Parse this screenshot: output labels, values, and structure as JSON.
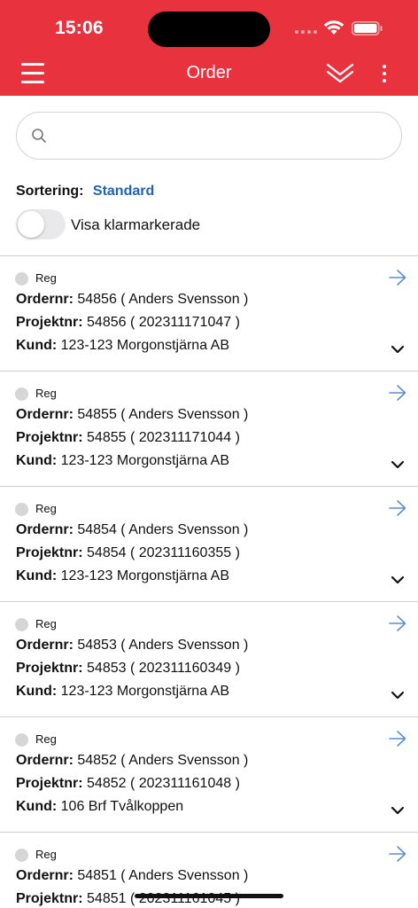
{
  "status_bar": {
    "time": "15:06"
  },
  "appbar": {
    "title": "Order",
    "bg_color": "#e8323e"
  },
  "search": {
    "placeholder": "",
    "value": ""
  },
  "sort": {
    "label": "Sortering:",
    "value": "Standard"
  },
  "toggle": {
    "label": "Visa klarmarkerade",
    "on": false
  },
  "labels": {
    "order": "Ordernr:",
    "project": "Projektnr:",
    "customer": "Kund:"
  },
  "orders": [
    {
      "status": "Reg",
      "order": "54856 ( Anders Svensson )",
      "project": "54856 ( 202311171047 )",
      "customer": "123-123 Morgonstjärna AB"
    },
    {
      "status": "Reg",
      "order": "54855 ( Anders Svensson )",
      "project": "54855 ( 202311171044 )",
      "customer": "123-123 Morgonstjärna AB"
    },
    {
      "status": "Reg",
      "order": "54854 ( Anders Svensson )",
      "project": "54854 ( 202311160355 )",
      "customer": "123-123 Morgonstjärna AB"
    },
    {
      "status": "Reg",
      "order": "54853 ( Anders Svensson )",
      "project": "54853 ( 202311160349 )",
      "customer": "123-123 Morgonstjärna AB"
    },
    {
      "status": "Reg",
      "order": "54852 ( Anders Svensson )",
      "project": "54852 ( 202311161048 )",
      "customer": "106 Brf Tvålkoppen"
    },
    {
      "status": "Reg",
      "order": "54851 ( Anders Svensson )",
      "project": "54851 ( 202311161045 )",
      "customer": ""
    }
  ]
}
